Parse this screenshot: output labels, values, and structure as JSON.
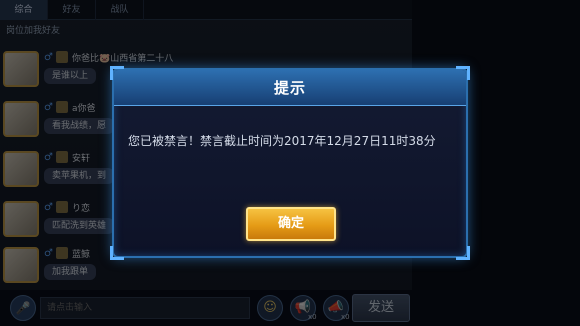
{
  "chat": {
    "tabs": [
      "综合",
      "好友",
      "战队"
    ],
    "system_line": "岗位加我好友",
    "messages": [
      {
        "name": "你爸比🐷山西省第二十八",
        "text": "是谁以上"
      },
      {
        "name": "a你爸",
        "text": "看我战绩，愿"
      },
      {
        "name": "安轩",
        "text": "卖苹果机，到"
      },
      {
        "name": "り恋",
        "text": "匹配洗到英雄"
      },
      {
        "name": "蓝鲸",
        "text": "加我跟单"
      }
    ]
  },
  "input": {
    "placeholder": "请点击输入"
  },
  "toolbar": {
    "send_label": "发送",
    "horn_count_1": "x0",
    "horn_count_2": "x0"
  },
  "dialog": {
    "title": "提示",
    "message": "您已被禁言！禁言截止时间为2017年12月27日11时38分",
    "confirm_label": "确定"
  },
  "icons": {
    "voice": "microphone-icon",
    "emoji": "emoji-icon",
    "horn": "horn-icon"
  },
  "colors": {
    "dialog_border": "#2b6fae",
    "header": "#2d6fb0",
    "confirm_button": "#e59b16"
  }
}
